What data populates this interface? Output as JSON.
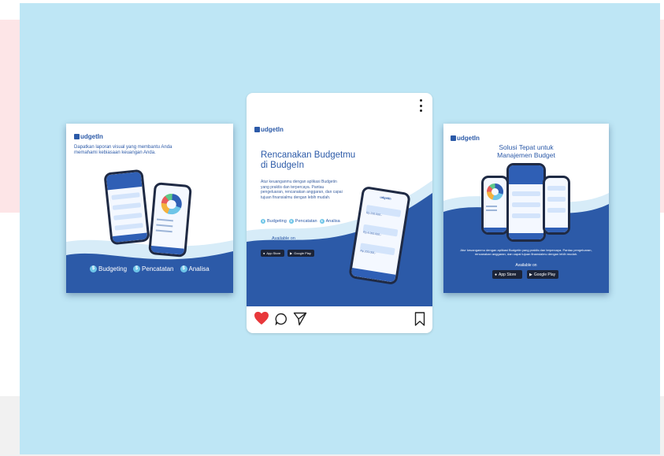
{
  "brand": {
    "name": "udgetIn",
    "color": "#2c5aa8",
    "accent": "#6ec5e8"
  },
  "left_card": {
    "headline": "Dapatkan laporan visual yang membantu Anda memahami kebiasaan keuangan Anda.",
    "features": [
      "Budgeting",
      "Pencatatan",
      "Analisa"
    ]
  },
  "post": {
    "menu_icon": "more-vertical-icon",
    "title": "Rencanakan Budgetmu di BudgeIn",
    "body": "Atur keuanganmu dengan aplikasi Budgetin yang praktis dan terpercaya. Pantau pengeluaran, rencanakan anggaran, dan capai tujuan finansialmu dengan lebih mudah.",
    "features": [
      "Budgeting",
      "Pencatatan",
      "Analisa"
    ],
    "available_on": "Available on",
    "app_store": "App Store",
    "google_play": "Google Play",
    "phone_values": [
      "Rp.200.000,-",
      "Rp.4.000.000,-",
      "Rp.200.000,-"
    ],
    "actions": {
      "like": "heart-icon",
      "comment": "comment-icon",
      "share": "send-icon",
      "save": "bookmark-icon"
    }
  },
  "right_card": {
    "headline": "Solusi Tepat untuk Manajemen Budget",
    "body": "Atur keuanganmu dengan aplikasi Budgetin yang praktis dan terpercaya. Pantau pengeluaran, rencanakan anggaran, dan capai tujuan finansialmu dengan lebih mudah.",
    "available_on": "Available on",
    "app_store": "App Store",
    "google_play": "Google Play"
  }
}
